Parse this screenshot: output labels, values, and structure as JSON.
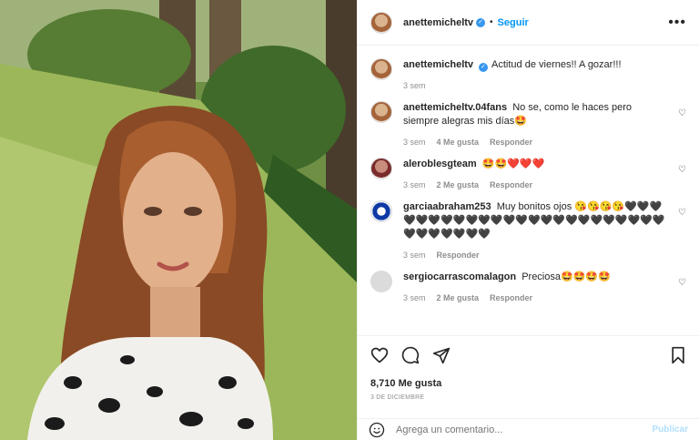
{
  "post": {
    "author": "anettemicheltv",
    "follow_label": "Seguir",
    "more_label": "•••",
    "caption": "Actitud de viernes!! A gozar!!!",
    "caption_time": "3 sem"
  },
  "comments": [
    {
      "user": "anettemicheltv.04fans",
      "text": "No se, como le haces pero siempre alegras mis días🤩",
      "time": "3 sem",
      "likes": "4 Me gusta",
      "reply": "Responder",
      "avatar": "avatar-photo"
    },
    {
      "user": "aleroblesgteam",
      "text": "🤩🤩❤️❤️❤️",
      "time": "3 sem",
      "likes": "2 Me gusta",
      "reply": "Responder",
      "avatar": "avatar-photo"
    },
    {
      "user": "garciaabraham253",
      "text": "Muy bonitos ojos 😘😘😘😘🖤🖤🖤🖤🖤🖤🖤🖤🖤🖤🖤🖤🖤🖤🖤🖤🖤🖤🖤🖤🖤🖤🖤🖤🖤🖤🖤🖤🖤🖤🖤",
      "time": "3 sem",
      "likes": "",
      "reply": "Responder",
      "avatar": "avatar-crest"
    },
    {
      "user": "sergiocarrascomalagon",
      "text": "Preciosa🤩🤩🤩🤩",
      "time": "3 sem",
      "likes": "2 Me gusta",
      "reply": "Responder",
      "avatar": "avatar-default"
    }
  ],
  "actions": {
    "like_icon": "heart-icon",
    "comment_icon": "comment-icon",
    "share_icon": "share-icon",
    "save_icon": "bookmark-icon",
    "likes_count": "8,710 Me gusta",
    "date": "3 DE DICIEMBRE"
  },
  "composer": {
    "placeholder": "Agrega un comentario...",
    "publish_label": "Publicar",
    "emoji_icon": "smiley-icon"
  },
  "colors": {
    "accent": "#0095f6",
    "verified": "#3897f0",
    "muted": "#8e8e8e",
    "publish_disabled": "#b2dffc"
  }
}
